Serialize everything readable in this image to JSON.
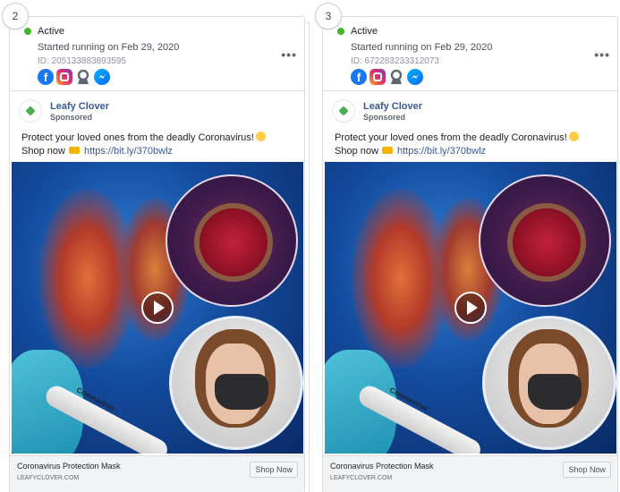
{
  "cards": [
    {
      "index": "2",
      "status": "Active",
      "started": "Started running on Feb 29, 2020",
      "ad_id": "ID: 205133883893595",
      "platform_icons": [
        "facebook-icon",
        "instagram-icon",
        "audience-network-icon",
        "messenger-icon"
      ],
      "more": "•••",
      "advertiser": "Leafy Clover",
      "sponsored": "Sponsored",
      "body_line1": "Protect your loved ones from the deadly Coronavirus!",
      "shop_now_text": "Shop now",
      "link": "https://bit.ly/370bwlz",
      "tube_label": "Coronavirus :",
      "footer_title": "Coronavirus Protection Mask",
      "footer_domain": "LEAFYCLOVER.COM",
      "cta": "Shop Now"
    },
    {
      "index": "3",
      "status": "Active",
      "started": "Started running on Feb 29, 2020",
      "ad_id": "ID: 672283233312073",
      "platform_icons": [
        "facebook-icon",
        "instagram-icon",
        "audience-network-icon",
        "messenger-icon"
      ],
      "more": "•••",
      "advertiser": "Leafy Clover",
      "sponsored": "Sponsored",
      "body_line1": "Protect your loved ones from the deadly Coronavirus!",
      "shop_now_text": "Shop now",
      "link": "https://bit.ly/370bwlz",
      "tube_label": "Coronavirus :",
      "footer_title": "Coronavirus Protection Mask",
      "footer_domain": "LEAFYCLOVER.COM",
      "cta": "Shop Now"
    }
  ],
  "colors": {
    "active_dot": "#42b72a",
    "link": "#385898",
    "facebook": "#1877f2"
  }
}
